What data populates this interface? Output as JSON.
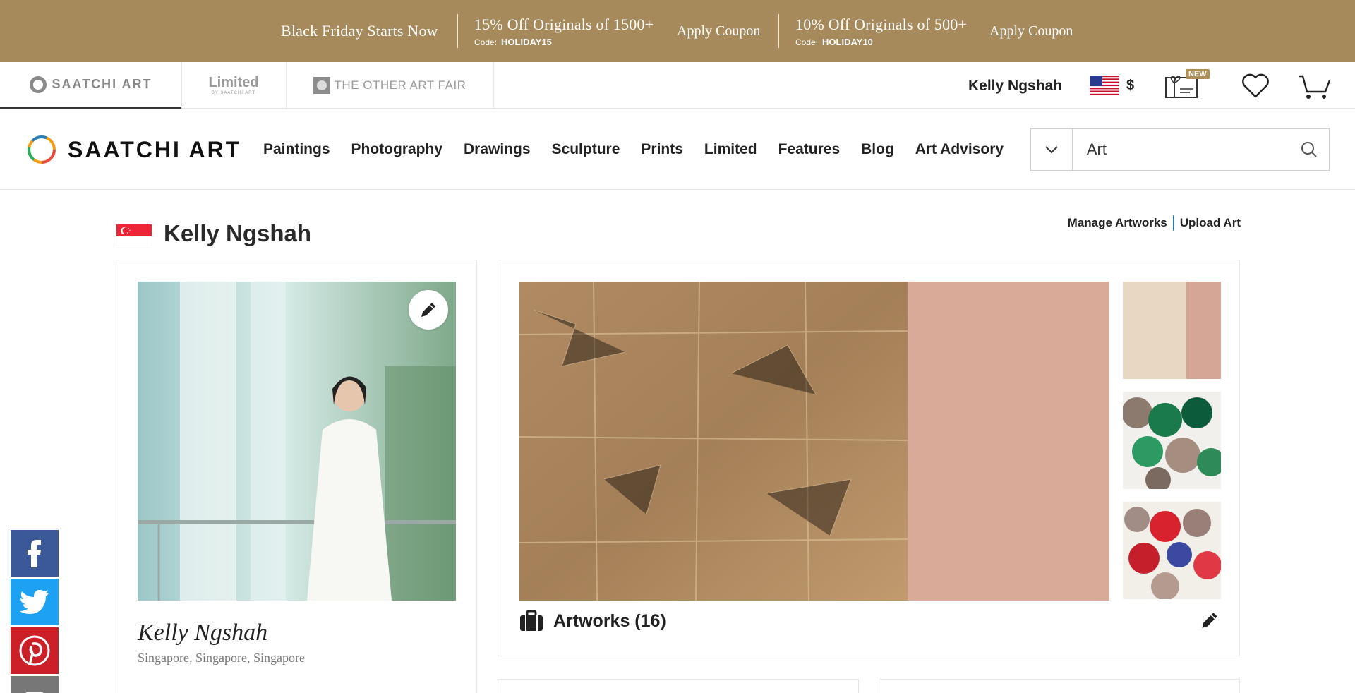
{
  "promo": {
    "headline": "Black Friday Starts Now",
    "offers": [
      {
        "title": "15% Off Originals of 1500+",
        "code_label": "Code:",
        "code": "HOLIDAY15",
        "apply": "Apply Coupon"
      },
      {
        "title": "10% Off Originals of 500+",
        "code_label": "Code:",
        "code": "HOLIDAY10",
        "apply": "Apply Coupon"
      }
    ],
    "bg_color": "#a68a5c"
  },
  "brands": {
    "saatchi": "SAATCHI ART",
    "limited": "Limited",
    "limited_sub": "BY SAATCHI ART",
    "other_art_fair": "THE OTHER ART FAIR"
  },
  "account": {
    "user_name": "Kelly Ngshah",
    "currency": "$",
    "new_badge": "NEW"
  },
  "nav": {
    "logo": "SAATCHI ART",
    "links": [
      "Paintings",
      "Photography",
      "Drawings",
      "Sculpture",
      "Prints",
      "Limited",
      "Features",
      "Blog",
      "Art Advisory"
    ]
  },
  "search": {
    "value": "Art",
    "placeholder": "Art"
  },
  "profile": {
    "title": "Kelly Ngshah",
    "manage": "Manage Artworks",
    "upload": "Upload Art",
    "artist_name": "Kelly Ngshah",
    "location": "Singapore, Singapore, Singapore",
    "artworks_label": "Artworks (16)"
  },
  "icons": {
    "social": [
      "facebook-icon",
      "twitter-icon",
      "pinterest-icon",
      "email-icon"
    ]
  },
  "colors": {
    "facebook": "#3b5998",
    "twitter": "#1da1f2",
    "pinterest": "#cb2027",
    "link_separator": "#2a7ab8"
  }
}
